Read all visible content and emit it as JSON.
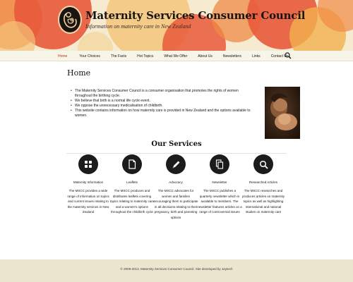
{
  "header": {
    "site_title": "Maternity Services Consumer Council",
    "tagline": "Information on maternity care in New Zealand",
    "logo_icon": "mother-and-child-logo-icon",
    "colors": {
      "background": "#f6ead0",
      "circle_red": "#e85a3b",
      "circle_orange": "#ef8a45",
      "circle_yellow": "#f2b04e"
    }
  },
  "nav": {
    "items": [
      {
        "label": "Home",
        "active": true
      },
      {
        "label": "Your Choices"
      },
      {
        "label": "The Facts"
      },
      {
        "label": "Hot Topics"
      },
      {
        "label": "What We Offer"
      },
      {
        "label": "About Us"
      },
      {
        "label": "Newsletters"
      },
      {
        "label": "Links"
      },
      {
        "label": "Contact Us"
      }
    ],
    "search_icon": "search-icon",
    "active_color": "#bc360a"
  },
  "main": {
    "title": "Home",
    "intro_items": [
      "The Maternity Services Consumer Council is a consumer organisation that promotes the rights of women throughout the birthing cycle.",
      "We believe that birth is a normal life cycle event.",
      "We oppose the unnecessary medicalisation of childbirth.",
      "This website contains information on how maternity care is provided in New Zealand and the options available to women."
    ],
    "photo_icon": "mother-and-baby-photo"
  },
  "services": {
    "title": "Our Services",
    "items": [
      {
        "icon": "grid-icon",
        "label": "Maternity Information",
        "description": "The MSCC provides a wide range of information on topics and current issues relating to the maternity services in New Zealand"
      },
      {
        "icon": "document-icon",
        "label": "Leaflets",
        "description": "The MSCC produces and distributes leaflets covering topics relating to maternity care and a women's options throughout the childbirth cycle"
      },
      {
        "icon": "pencil-icon",
        "label": "Advocacy",
        "description": "The MSCC advocates for women and families encouraging them to participate in all decisions relating to their pregnancy, birth and parenting options"
      },
      {
        "icon": "copy-icon",
        "label": "Newsletter",
        "description": "The MSCC publishes a quarterly newsletter which is available to members. The newsletter features articles on a range of controversial issues"
      },
      {
        "icon": "search-icon",
        "label": "Researched Articles",
        "description": "The MSCC researches and produces articles on maternity topics as well as highlighting international and national studies on maternity care"
      }
    ]
  },
  "footer": {
    "text": "© 2009-2013. Maternity Services Consumer Council. Site developed by Jaytech"
  }
}
